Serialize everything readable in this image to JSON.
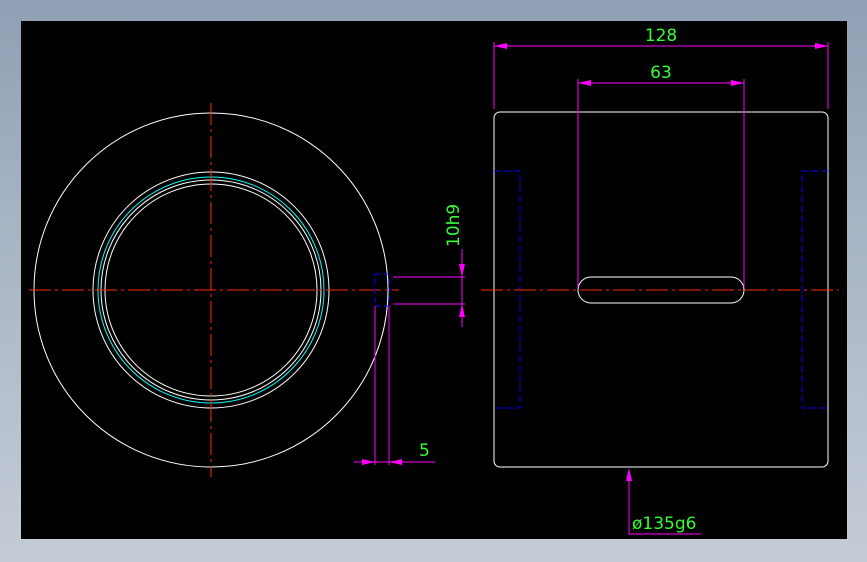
{
  "colors": {
    "background": "#000000",
    "frame": "#a9b6c6",
    "outline": "#ffffff",
    "centerline": "#ff2a00",
    "dimension_line": "#ff00ff",
    "dimension_text": "#33ff33",
    "hidden_line": "#0000ff",
    "inner_ring": "#00ffff"
  },
  "dimensions": {
    "overall_width": "128",
    "slot_length": "63",
    "keyway_width": "10h9",
    "keyway_depth": "5",
    "diameter": "ø135g6"
  },
  "icons": {
    "arrowhead": "arrowhead-icon"
  }
}
